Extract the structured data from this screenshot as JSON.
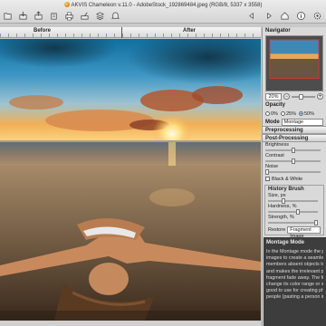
{
  "window": {
    "title": "AKVIS Chameleon v.11.0 - AdobeStock_192869484.jpeg (RGB/8, 5337 x 3558)"
  },
  "toolbar": {
    "left_icons": [
      "open-file-icon",
      "save-file-icon",
      "image-stack-icon",
      "batch-icon",
      "print-icon",
      "share-icon",
      "layers-icon",
      "bell-icon"
    ],
    "right_icons": [
      "undo-icon",
      "redo-icon",
      "home-icon",
      "info-icon",
      "settings-icon"
    ]
  },
  "view": {
    "before_label": "Before",
    "after_label": "After"
  },
  "navigator": {
    "title": "Navigator",
    "zoom": "20%"
  },
  "opacity": {
    "title": "Opacity",
    "options": [
      "0%",
      "25%",
      "50%"
    ],
    "selected": 2
  },
  "mode": {
    "label": "Mode",
    "value": "Montage"
  },
  "groups": {
    "preprocessing": "Preprocessing",
    "postprocessing": "Post-Processing"
  },
  "post": {
    "brightness_label": "Brightness",
    "brightness_value": 0.5,
    "contrast_label": "Contrast",
    "contrast_value": 0.5,
    "noise_label": "Noise",
    "noise_value": 0.0,
    "bw_label": "Black & White"
  },
  "history_brush": {
    "title": "History Brush",
    "size_label": "Size, px",
    "size_value": 0.3,
    "hardness_label": "Hardness, %",
    "hardness_value": 0.6,
    "strength_label": "Strength, %",
    "strength_value": 1.0,
    "restore_label": "Restore",
    "restore_value": "Fragment Image"
  },
  "help": {
    "title": "Montage Mode",
    "lines": [
      "In the Montage mode the prog",
      "images to create a seamless",
      "members absent objects to a",
      "and makes the irrelevant part",
      "fragment fade away. The fragm",
      "change its color range or size",
      "good to use for creating photo",
      "people (pasting a person into"
    ],
    "bold_word": "Montage"
  },
  "colors": {
    "accent": "#2a6bd8",
    "help_bg": "#3d3d3d"
  }
}
